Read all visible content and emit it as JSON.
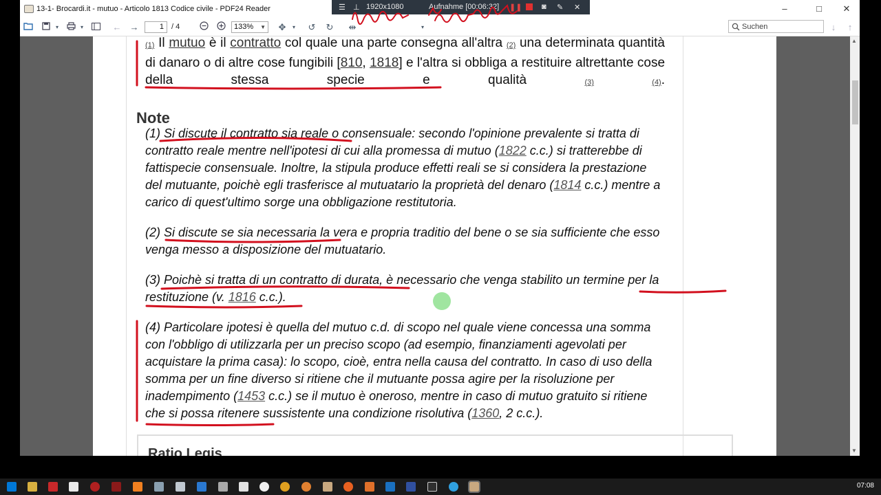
{
  "window": {
    "title": "13-1- Brocardi.it - mutuo - Articolo 1813 Codice civile - PDF24 Reader",
    "controls": {
      "minimize": "–",
      "maximize": "□",
      "close": "✕"
    }
  },
  "recorder": {
    "resolution": "1920x1080",
    "status": "Aufnahme [00:06:32]"
  },
  "toolbar": {
    "page_current": "1",
    "page_total": "/ 4",
    "zoom_value": "133%",
    "search_placeholder": "Suchen"
  },
  "document": {
    "article": {
      "fn1": "(1)",
      "t1": " Il ",
      "mutuo": "mutuo",
      "t2": " è il ",
      "contratto": "contratto",
      "t3": " col quale una parte consegna all'altra ",
      "fn2": "(2)",
      "t4": " una determinata quantità di danaro o di altre cose fungibili [",
      "ref810": "810",
      "comma": ", ",
      "ref1818": "1818",
      "t5": "] e l'altra si obbliga a restituire altrettante cose della stessa specie e qualità ",
      "fn3": "(3)",
      "fn4": "(4)",
      "period": "."
    },
    "note_heading": "Note",
    "notes": [
      {
        "a": "(1) Si discute il contratto sia reale o consensuale: secondo l'opinione prevalente si tratta di contratto reale mentre nell'ipotesi di cui alla promessa di mutuo (",
        "r1": "1822",
        "b": " c.c.) si tratterebbe di fattispecie consensuale. Inoltre, la stipula produce effetti reali se si considera la prestazione del mutuante, poichè egli trasferisce al mutuatario la proprietà del denaro (",
        "r2": "1814",
        "c": " c.c.) mentre a carico di quest'ultimo sorge una obbligazione restitutoria."
      },
      {
        "a": "(2) Si discute se sia necessaria la vera e propria traditio del bene o se sia sufficiente che esso venga messo a disposizione del mutuatario."
      },
      {
        "a": "(3) Poichè si tratta di un contratto di durata, è necessario che venga stabilito un termine per la restituzione (v. ",
        "r1": "1816",
        "b": " c.c.)."
      },
      {
        "a": "(4) Particolare ipotesi è quella del mutuo c.d. di scopo nel quale viene concessa una somma con l'obbligo di utilizzarla per un preciso scopo (ad esempio, finanziamenti agevolati per acquistare la prima casa): lo scopo, cioè, entra nella causa del contratto. In caso di uso della somma per un fine diverso si ritiene che il mutuante possa agire per la risoluzione per inadempimento (",
        "r1": "1453",
        "b": " c.c.) se il mutuo è oneroso, mentre in caso di mutuo gratuito si ritiene che si possa ritenere sussistente una condizione risolutiva (",
        "r2": "1360",
        "c": ", 2 c.c.)."
      }
    ],
    "ratio_heading": "Ratio Legis"
  },
  "handwriting": "Elementi del mutuo",
  "taskbar": {
    "clock": "07:08"
  },
  "colors": {
    "ink": "#d2101e",
    "doc_bg": "#5f5f5f",
    "cursor_dot": "#8fe08f",
    "taskbar": "#1b1b1b"
  }
}
